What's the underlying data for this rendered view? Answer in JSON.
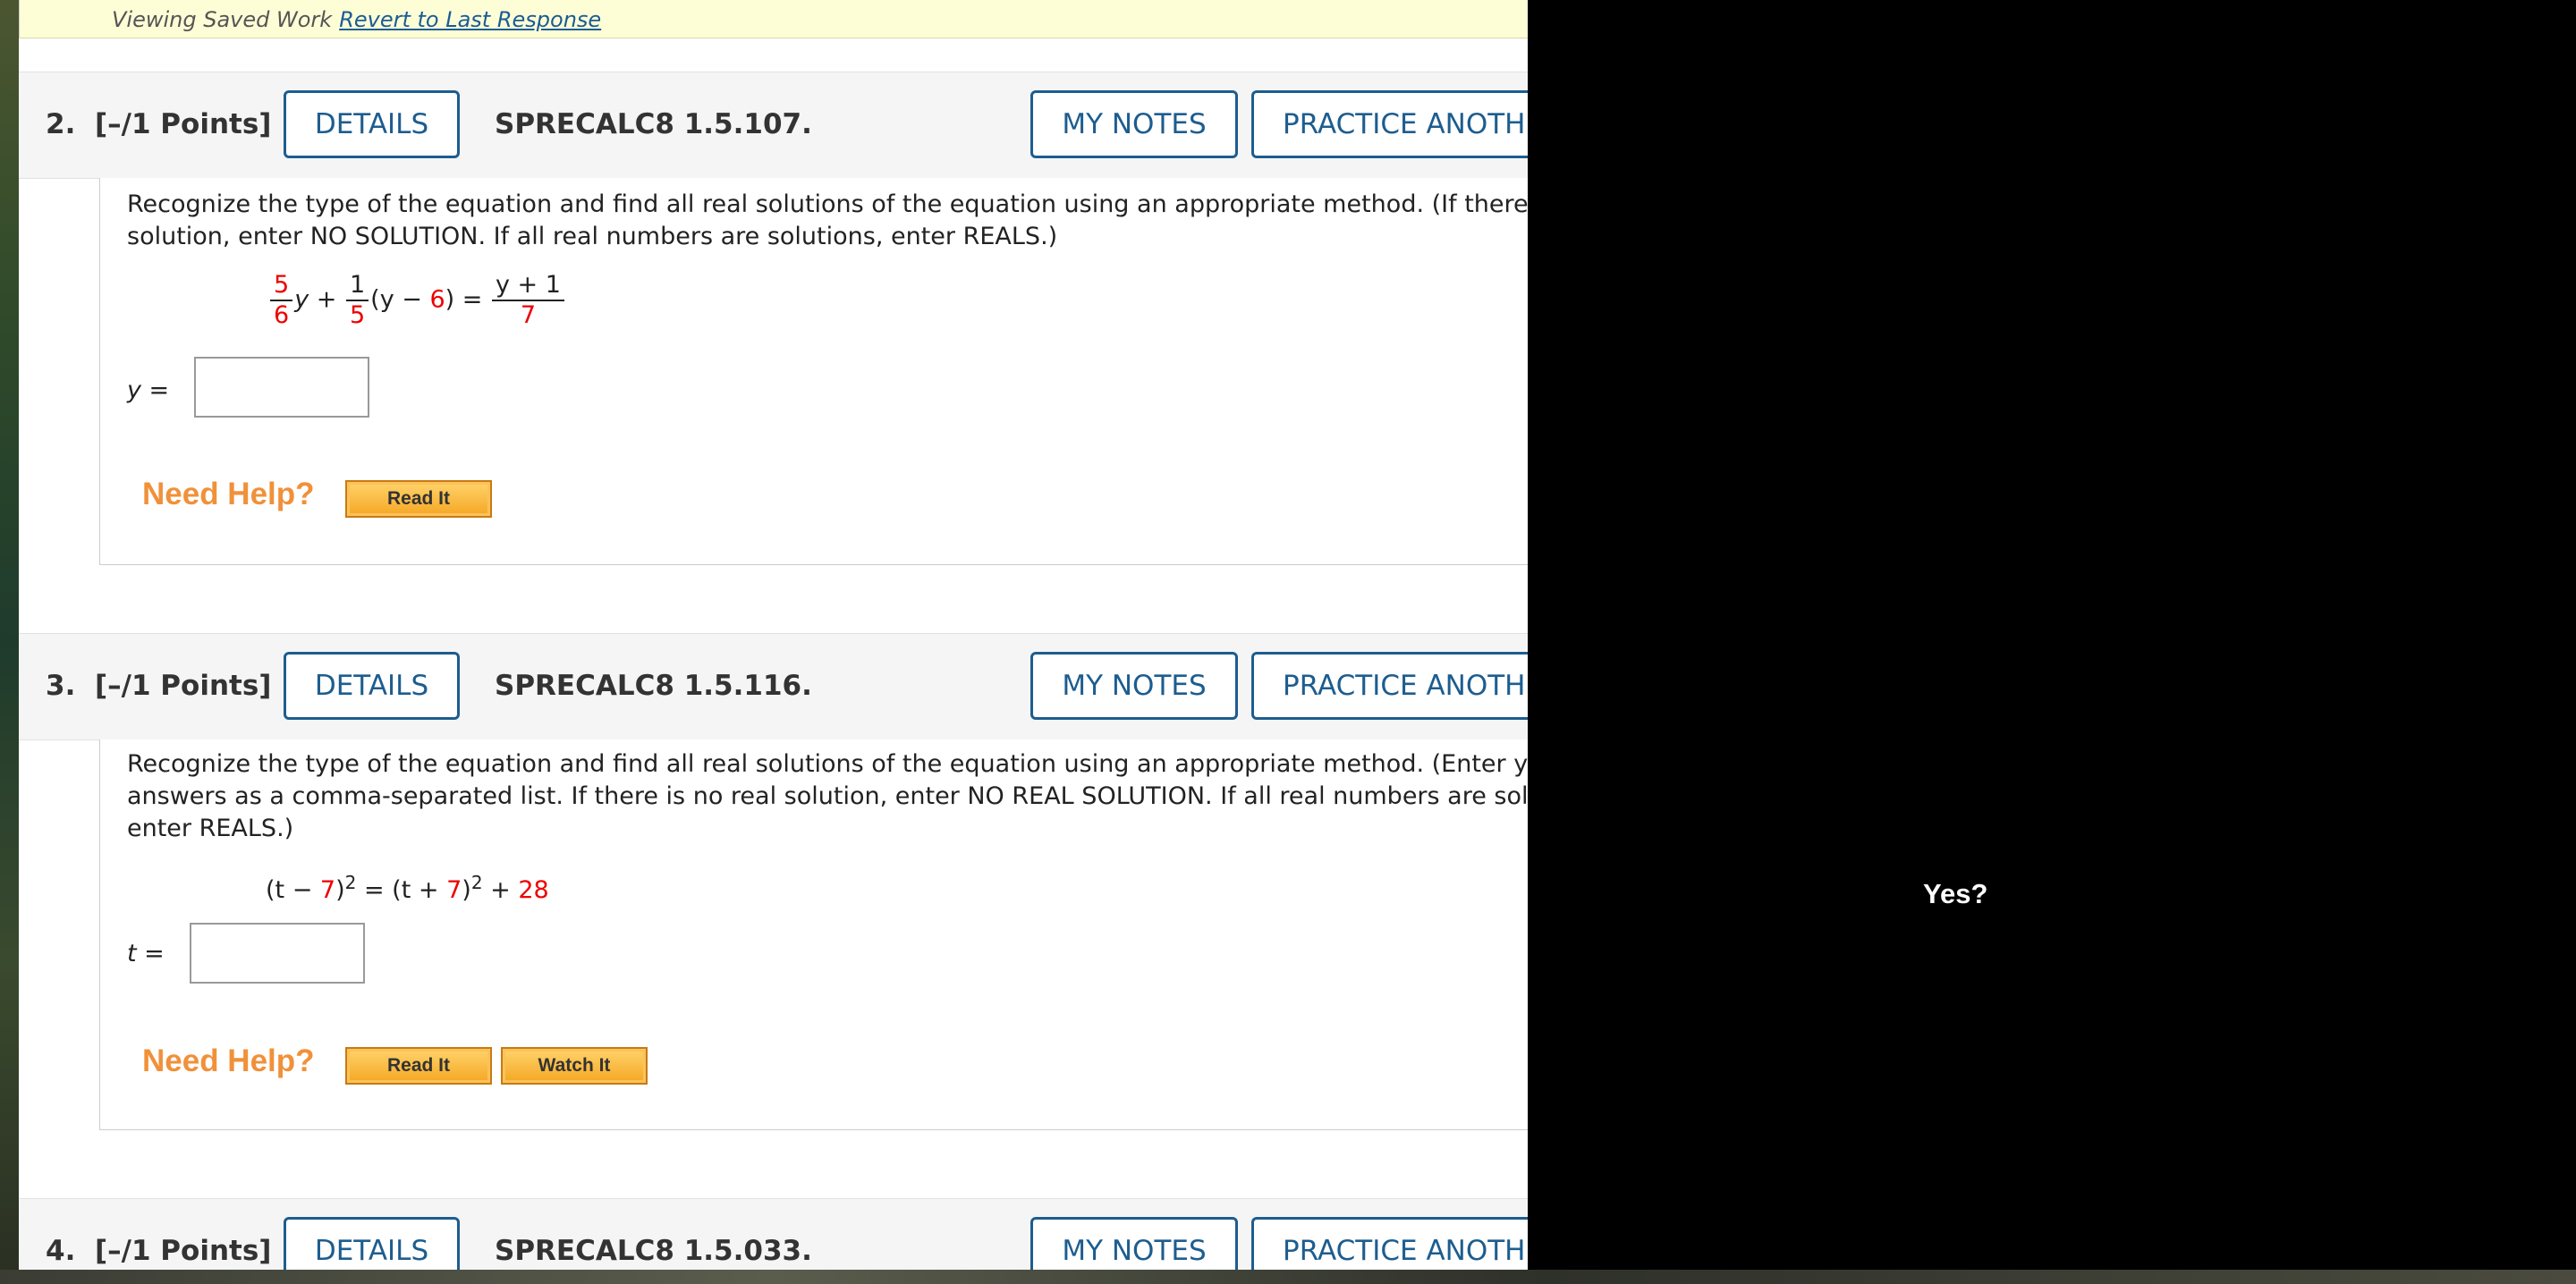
{
  "saved_bar": {
    "text": "Viewing Saved Work",
    "link": "Revert to Last Response"
  },
  "questions": [
    {
      "number": "2.",
      "points": "[–/1 Points]",
      "details": "DETAILS",
      "code": "SPRECALC8 1.5.107.",
      "notes": "MY NOTES",
      "practice": "PRACTICE ANOTHER",
      "text_line1": "Recognize the type of the equation and find all real solutions of the equation using an appropriate method. (If there is no",
      "text_line2": "solution, enter NO SOLUTION. If all real numbers are solutions, enter REALS.)",
      "equation": {
        "f1_num": "5",
        "f1_den": "6",
        "var1": "y +",
        "f2_num": "1",
        "f2_den": "5",
        "mid_a": "(y − ",
        "mid_b": "6",
        "mid_c": ") =",
        "rhs_num": "y + 1",
        "rhs_den": "7"
      },
      "answer_label": "y =",
      "need_help": "Need Help?",
      "help_buttons": [
        "Read It"
      ]
    },
    {
      "number": "3.",
      "points": "[–/1 Points]",
      "details": "DETAILS",
      "code": "SPRECALC8 1.5.116.",
      "notes": "MY NOTES",
      "practice": "PRACTICE ANOTHER",
      "text_line1": "Recognize the type of the equation and find all real solutions of the equation using an appropriate method. (Enter your",
      "text_line2": "answers as a comma-separated list. If there is no real solution, enter NO REAL SOLUTION. If all real numbers are solutions,",
      "text_line3": "enter REALS.)",
      "equation": {
        "a": "(t − ",
        "b": "7",
        "c": ")",
        "d": "2",
        "e": " = (t + ",
        "f": "7",
        "g": ")",
        "h": "2",
        "i": " + ",
        "j": "28"
      },
      "answer_label": "t =",
      "need_help": "Need Help?",
      "help_buttons": [
        "Read It",
        "Watch It"
      ]
    },
    {
      "number": "4.",
      "points": "[–/1 Points]",
      "details": "DETAILS",
      "code": "SPRECALC8 1.5.033.",
      "notes": "MY NOTES",
      "practice": "PRACTICE ANOTHER"
    }
  ],
  "overlay": {
    "prompt": "Yes?"
  }
}
